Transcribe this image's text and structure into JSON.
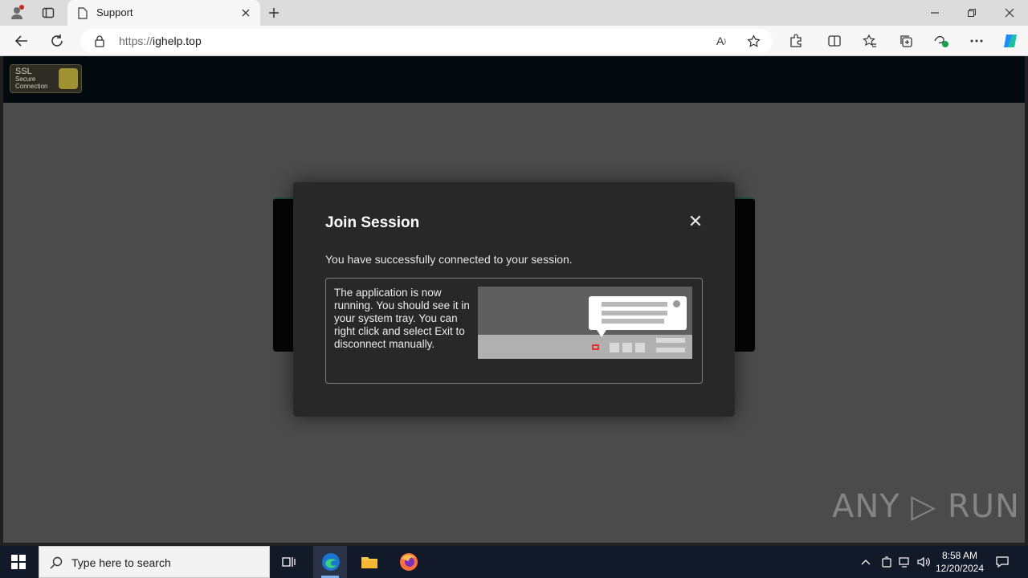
{
  "browser": {
    "tab_title": "Support",
    "url_scheme": "https://",
    "url_host": "ighelp.top",
    "window_controls": [
      "minimize",
      "restore",
      "close"
    ]
  },
  "site": {
    "ssl_badge": {
      "line1": "SSL",
      "line2": "Secure",
      "line3": "Connection"
    }
  },
  "modal": {
    "title": "Join Session",
    "close_glyph": "✕",
    "message": "You have successfully connected to your session.",
    "info_text": "The application is now running. You should see it in your system tray. You can right click and select Exit to disconnect manually."
  },
  "watermark": "ANY ▷ RUN",
  "taskbar": {
    "search_placeholder": "Type here to search",
    "time": "8:58 AM",
    "date": "12/20/2024",
    "accent": "#7fb3f0"
  }
}
